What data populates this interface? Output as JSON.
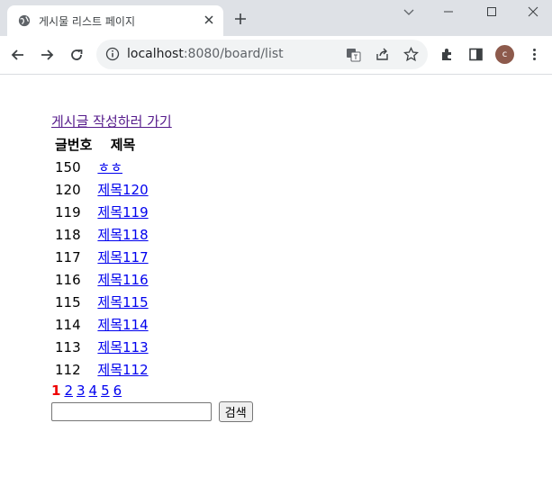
{
  "browser": {
    "tab_title": "게시물 리스트 페이지",
    "url_host": "localhost",
    "url_path": ":8080/board/list",
    "profile_initial": "c",
    "profile_color": "#8d5a4c"
  },
  "page": {
    "write_link": "게시글 작성하러 가기",
    "table": {
      "headers": [
        "글번호",
        "제목"
      ],
      "rows": [
        {
          "no": "150",
          "title": "ㅎㅎ"
        },
        {
          "no": "120",
          "title": "제목120"
        },
        {
          "no": "119",
          "title": "제목119"
        },
        {
          "no": "118",
          "title": "제목118"
        },
        {
          "no": "117",
          "title": "제목117"
        },
        {
          "no": "116",
          "title": "제목116"
        },
        {
          "no": "115",
          "title": "제목115"
        },
        {
          "no": "114",
          "title": "제목114"
        },
        {
          "no": "113",
          "title": "제목113"
        },
        {
          "no": "112",
          "title": "제목112"
        }
      ]
    },
    "pagination": {
      "current": "1",
      "pages": [
        "2",
        "3",
        "4",
        "5",
        "6"
      ]
    },
    "search": {
      "value": "",
      "button_label": "검색"
    }
  },
  "colors": {
    "link": "#0000ee",
    "visited_link": "#551a8b",
    "current_page": "#ee0000"
  }
}
